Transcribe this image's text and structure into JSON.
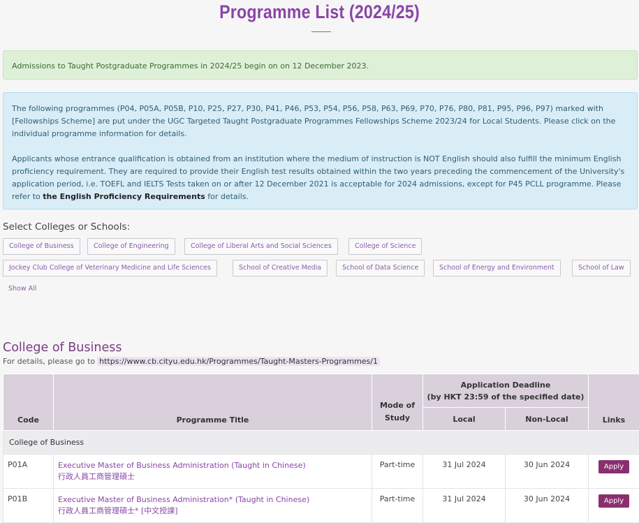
{
  "page": {
    "title": "Programme List (2024/25)"
  },
  "alerts": {
    "success": "Admissions to Taught Postgraduate Programmes in 2024/25 begin on on 12 December 2023.",
    "info_p1": "The following programmes (P04, P05A, P05B, P10, P25, P27, P30, P41, P46, P53, P54, P56, P58, P63, P69, P70, P76, P80, P81, P95, P96, P97) marked with [Fellowships Scheme] are put under the UGC Targeted Taught Postgraduate Programmes Fellowships Scheme 2023/24 for Local Students. Please click on the individual programme information for details.",
    "info_p2_pre": "Applicants whose entrance qualification is obtained from an institution where the medium of instruction is NOT English should also fulfill the minimum English proficiency requirement. They are required to provide their English test results obtained within the two years preceding the commencement of the University's application period, i.e. TOEFL and IELTS Tests taken on or after 12 December 2021 is acceptable for 2024 admissions, except for P45 PCLL programme. Please refer to ",
    "info_p2_link": "the English Proficiency Requirements",
    "info_p2_post": " for details."
  },
  "filters": {
    "heading": "Select Colleges or Schools:",
    "chips": [
      "College of Business",
      "College of Engineering",
      "College of Liberal Arts and Social Sciences",
      "College of Science",
      "Jockey Club College of Veterinary Medicine and Life Sciences",
      "School of Creative Media",
      "School of Data Science",
      "School of Energy and Environment",
      "School of Law"
    ],
    "show_all": "Show All"
  },
  "section": {
    "title": "College of Business",
    "details_prefix": "For details, please go to",
    "details_url": "https://www.cb.cityu.edu.hk/Programmes/Taught-Masters-Programmes/1"
  },
  "table": {
    "headers": {
      "code": "Code",
      "title": "Programme Title",
      "mode": "Mode of Study",
      "deadline_line1": "Application Deadline",
      "deadline_line2": "(by HKT 23:59 of the specified date)",
      "local": "Local",
      "nonlocal": "Non-Local",
      "links": "Links"
    },
    "group": "College of Business",
    "rows": [
      {
        "code": "P01A",
        "title_en": "Executive Master of Business Administration (Taught in Chinese)",
        "title_zh": "行政人員工商管理碩士",
        "mode": "Part-time",
        "local": "31 Jul 2024",
        "nonlocal": "30 Jun 2024",
        "link": "Apply"
      },
      {
        "code": "P01B",
        "title_en": "Executive Master of Business Administration* (Taught in Chinese)",
        "title_zh": "行政人員工商管理碩士* [中文授課]",
        "mode": "Part-time",
        "local": "31 Jul 2024",
        "nonlocal": "30 Jun 2024",
        "link": "Apply"
      }
    ]
  },
  "colors": {
    "accent": "#8a45a6",
    "apply_button": "#8a2f6e",
    "success_bg": "#dff0d8",
    "info_bg": "#d9edf7",
    "table_header": "#d9d0dc"
  }
}
